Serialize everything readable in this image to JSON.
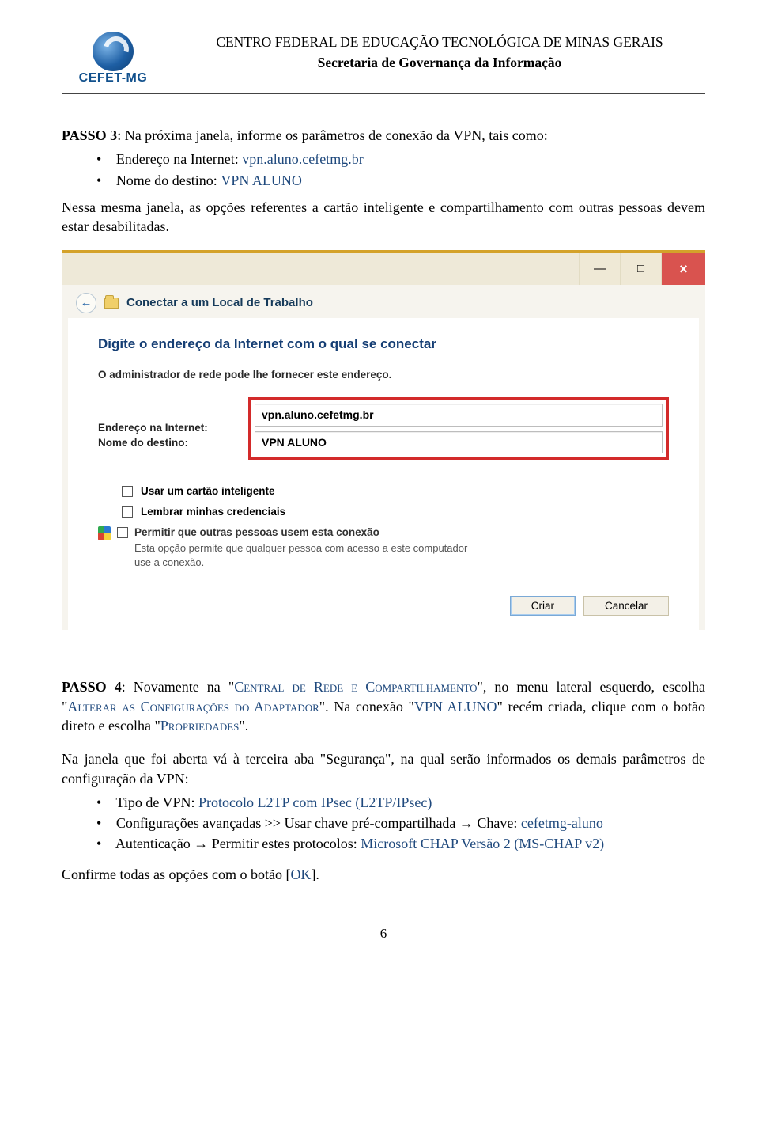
{
  "header": {
    "logo_text": "CEFET-MG",
    "title1": "CENTRO FEDERAL DE EDUCAÇÃO TECNOLÓGICA DE MINAS GERAIS",
    "title2": "Secretaria de Governança da Informação"
  },
  "step3": {
    "prefix": "PASSO 3",
    "intro": ": Na próxima janela, informe os parâmetros de conexão da VPN, tais como:",
    "b1_label": "Endereço na Internet: ",
    "b1_value": "vpn.aluno.cefetmg.br",
    "b2_label": "Nome do destino: ",
    "b2_value": "VPN ALUNO",
    "note": "Nessa mesma janela, as opções referentes a cartão inteligente e compartilhamento com outras pessoas devem estar desabilitadas."
  },
  "window": {
    "back_glyph": "←",
    "header_text": "Conectar a um Local de Trabalho",
    "heading": "Digite o endereço da Internet com o qual se conectar",
    "subheading": "O administrador de rede pode lhe fornecer este endereço.",
    "lbl_addr": "Endereço na Internet:",
    "lbl_dest": "Nome do destino:",
    "val_addr": "vpn.aluno.cefetmg.br",
    "val_dest": "VPN ALUNO",
    "opt_smartcard": "Usar um cartão inteligente",
    "opt_remember": "Lembrar minhas credenciais",
    "opt_share": "Permitir que outras pessoas usem esta conexão",
    "opt_share_sub": "Esta opção permite que qualquer pessoa com acesso a este computador use a conexão.",
    "btn_create": "Criar",
    "btn_cancel": "Cancelar",
    "btn_min": "—",
    "btn_max": "□",
    "btn_close": "×"
  },
  "step4": {
    "prefix": "PASSO 4",
    "part_a": ": Novamente na \"",
    "central": "Central de Rede e Compartilhamento",
    "part_b": "\", no menu lateral esquerdo, escolha \"",
    "alterar": "Alterar as Configurações do Adaptador",
    "part_c": "\". Na conexão \"",
    "vpn_aluno": "VPN ALUNO",
    "part_d": "\" recém criada, clique com o botão direto e escolha \"",
    "propriedades": "Propriedades",
    "part_e": "\".",
    "para2": "Na janela que foi aberta vá à terceira aba \"Segurança\", na qual serão informados os demais parâmetros de configuração da VPN:",
    "bullet1_label": "Tipo de VPN: ",
    "bullet1_value": "Protocolo L2TP com IPsec (L2TP/IPsec)",
    "bullet2_a": "Configurações avançadas >> Usar chave pré-compartilhada ",
    "bullet2_arrow": "→",
    "bullet2_b": " Chave: ",
    "bullet2_value": "cefetmg-aluno",
    "bullet3_a": "Autenticação ",
    "bullet3_arrow": "→",
    "bullet3_b": " Permitir estes protocolos: ",
    "bullet3_value": "Microsoft CHAP Versão 2 (MS-CHAP v2)",
    "confirm_a": "Confirme todas as opções com o botão [",
    "confirm_ok": "OK",
    "confirm_b": "]."
  },
  "page_number": "6"
}
